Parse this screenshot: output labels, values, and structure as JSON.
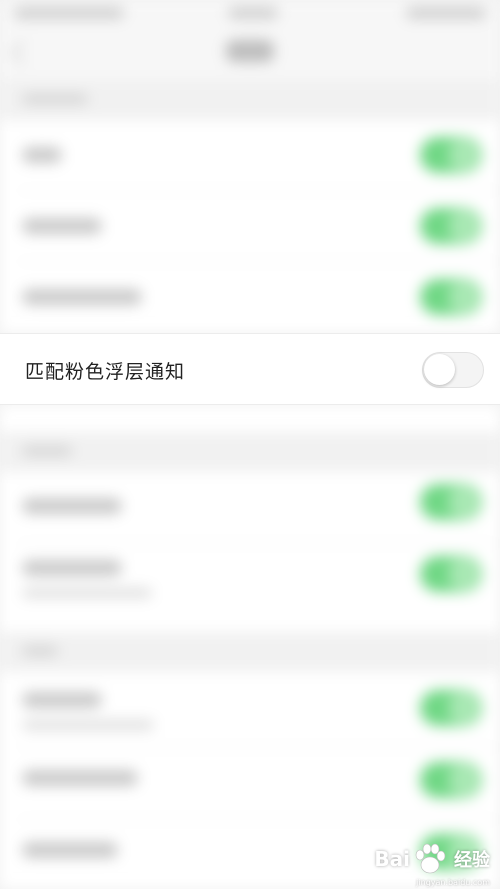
{
  "setting": {
    "label": "匹配粉色浮层通知",
    "enabled": false
  },
  "watermark": {
    "brand_left": "Bai",
    "brand_right": "经验",
    "url": "jingyan.baidu.com"
  },
  "colors": {
    "toggle_on": "#6fd784",
    "toggle_off_track": "#f4f4f4",
    "background": "#f2f2f2"
  }
}
